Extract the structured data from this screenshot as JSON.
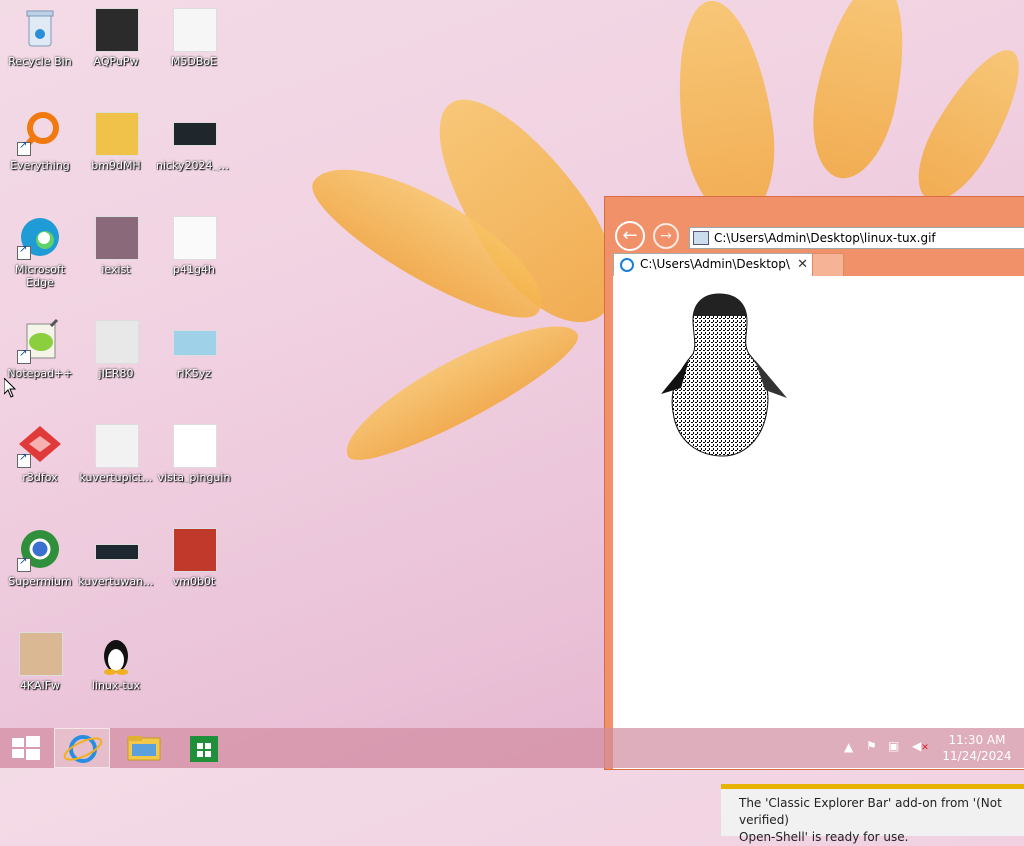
{
  "desktop": {
    "icons": [
      {
        "label": "Recycle Bin"
      },
      {
        "label": "AQPuPw"
      },
      {
        "label": "M5DBoE"
      },
      {
        "label": "Everything"
      },
      {
        "label": "bm9dMH"
      },
      {
        "label": "nicky2024_r..."
      },
      {
        "label": "Microsoft Edge"
      },
      {
        "label": "iexist"
      },
      {
        "label": "p41g4h"
      },
      {
        "label": "Notepad++"
      },
      {
        "label": "jIER80"
      },
      {
        "label": "rIK5yz"
      },
      {
        "label": "r3dfox"
      },
      {
        "label": "kuvertupict..."
      },
      {
        "label": "vista_pinguin"
      },
      {
        "label": "Supermium"
      },
      {
        "label": "kuvertuwan..."
      },
      {
        "label": "vm0b0t"
      },
      {
        "label": "4KAIFw"
      },
      {
        "label": "linux-tux"
      }
    ]
  },
  "browser": {
    "address": "C:\\Users\\Admin\\Desktop\\linux-tux.gif",
    "tab_title": "C:\\Users\\Admin\\Desktop\\li...",
    "back_icon": "←",
    "forward_icon": "→",
    "close_tab": "✕",
    "notification": {
      "line1": "The 'Classic Explorer Bar' add-on from '(Not verified)",
      "line2": "Open-Shell' is ready for use."
    }
  },
  "taskbar": {
    "time": "11:30 AM",
    "date": "11/24/2024"
  },
  "colors": {
    "window_frame": "#f0916a",
    "notification_accent": "#e8b200"
  }
}
